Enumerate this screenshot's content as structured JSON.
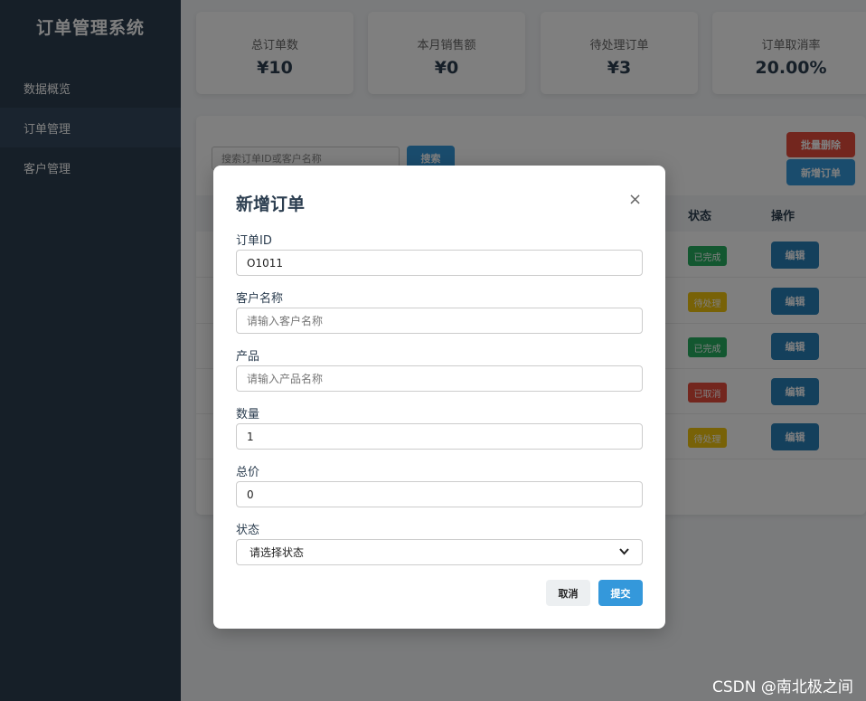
{
  "sidebar": {
    "brand": "订单管理系统",
    "items": [
      {
        "label": "数据概览"
      },
      {
        "label": "订单管理"
      },
      {
        "label": "客户管理"
      }
    ]
  },
  "stats": [
    {
      "label": "总订单数",
      "value": "¥10"
    },
    {
      "label": "本月销售额",
      "value": "¥0"
    },
    {
      "label": "待处理订单",
      "value": "¥3"
    },
    {
      "label": "订单取消率",
      "value": "20.00%"
    }
  ],
  "toolbar": {
    "search_placeholder": "搜索订单ID或客户名称",
    "search_label": "搜索",
    "batch_delete_label": "批量删除",
    "new_order_label": "新增订单"
  },
  "table": {
    "headers": {
      "status": "状态",
      "actions": "操作"
    },
    "rows": [
      {
        "status": "已完成",
        "status_type": "done",
        "action": "编辑"
      },
      {
        "status": "待处理",
        "status_type": "pending",
        "action": "编辑"
      },
      {
        "status": "已完成",
        "status_type": "done",
        "action": "编辑"
      },
      {
        "status": "已取消",
        "status_type": "cancel",
        "action": "编辑"
      },
      {
        "status": "待处理",
        "status_type": "pending",
        "action": "编辑"
      }
    ]
  },
  "modal": {
    "title": "新增订单",
    "close_glyph": "×",
    "fields": {
      "order_id": {
        "label": "订单ID",
        "value": "O1011",
        "placeholder": ""
      },
      "customer": {
        "label": "客户名称",
        "value": "",
        "placeholder": "请输入客户名称"
      },
      "product": {
        "label": "产品",
        "value": "",
        "placeholder": "请输入产品名称"
      },
      "quantity": {
        "label": "数量",
        "value": "1",
        "placeholder": ""
      },
      "total": {
        "label": "总价",
        "value": "0",
        "placeholder": ""
      },
      "status": {
        "label": "状态",
        "selected": "请选择状态"
      }
    },
    "cancel_label": "取消",
    "submit_label": "提交"
  },
  "watermark": "CSDN @南北极之间",
  "colors": {
    "sidebar": "#2c3e50",
    "primary": "#3498db",
    "danger": "#e74c3c",
    "success": "#27ae60",
    "warning": "#f1c40f"
  }
}
